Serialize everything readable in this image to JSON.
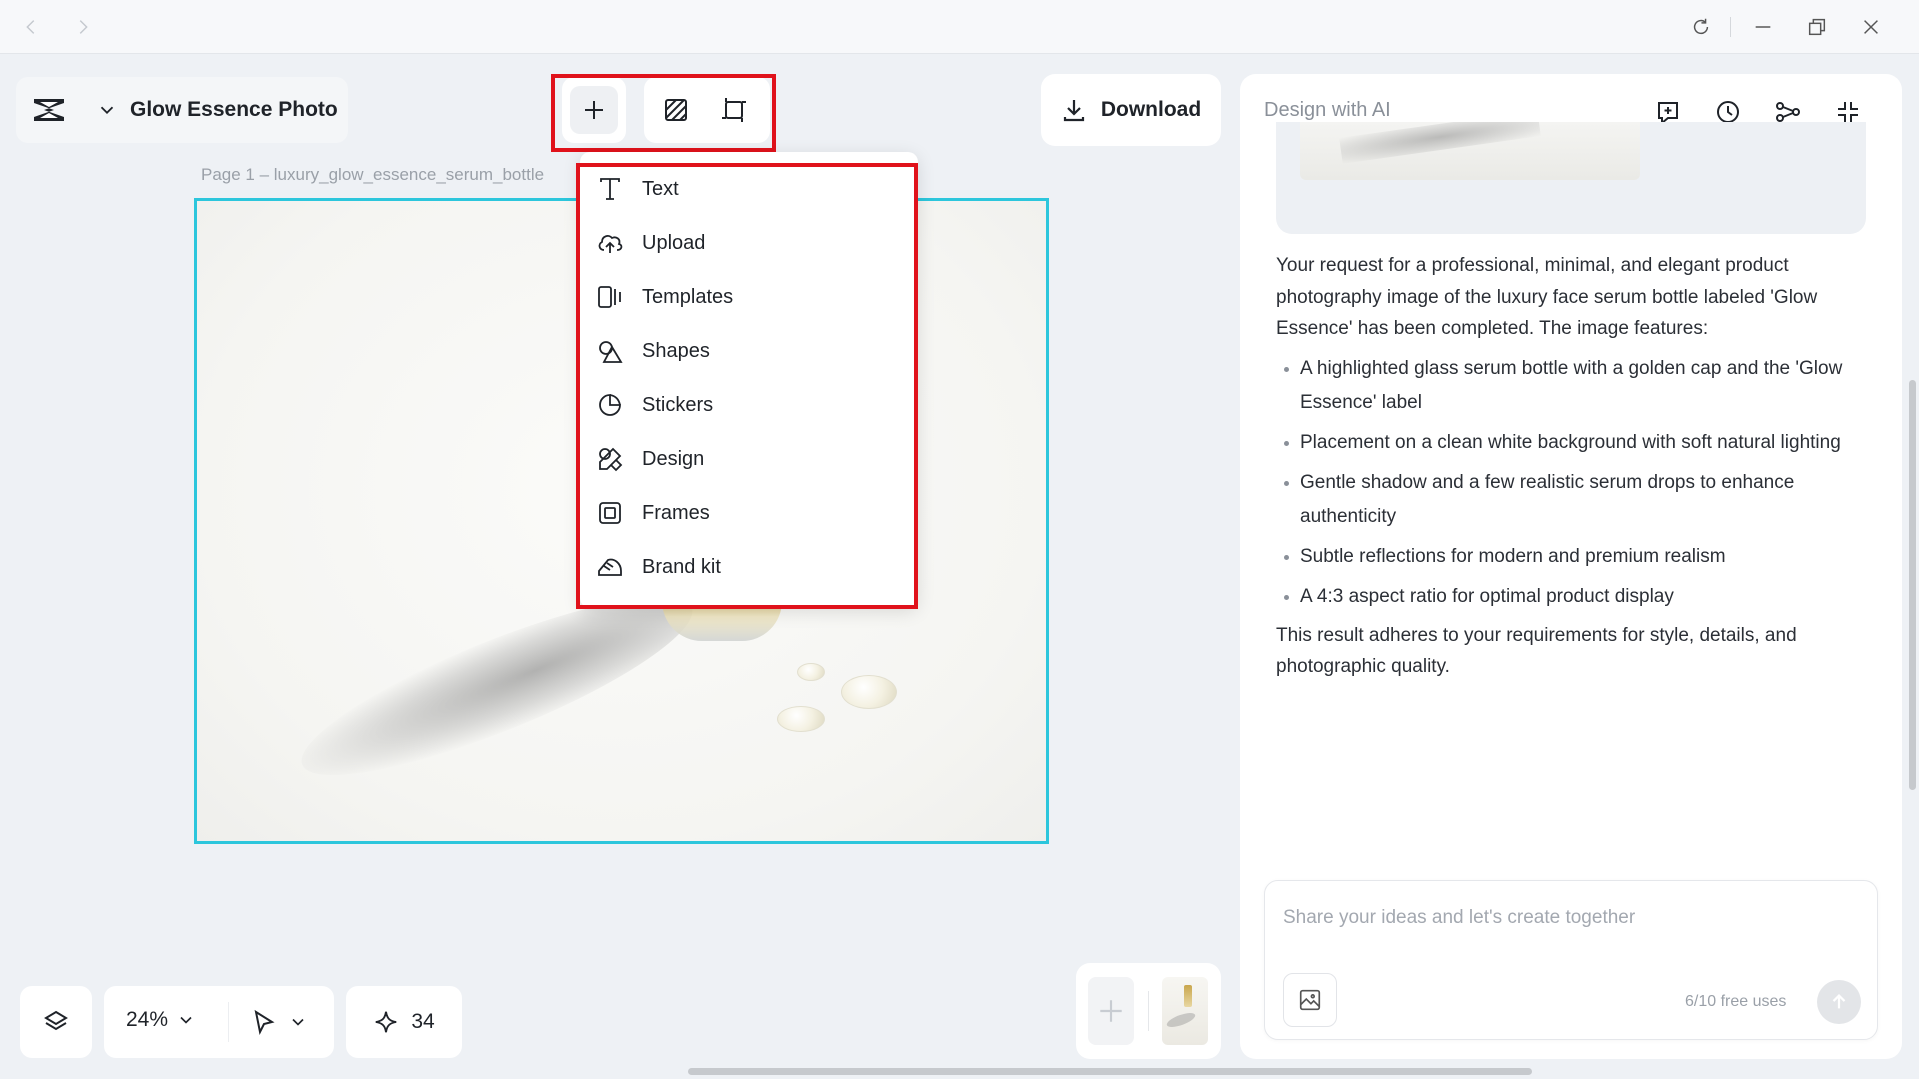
{
  "window": {
    "back_icon": "chevron-left-icon",
    "forward_icon": "chevron-right-icon",
    "reload_icon": "reload-icon",
    "minimize_icon": "minimize-icon",
    "restore_icon": "restore-icon",
    "close_icon": "close-icon"
  },
  "project": {
    "title": "Glow Essence Photo"
  },
  "toolbar": {
    "add_icon": "plus-icon",
    "background_icon": "background-pattern-icon",
    "resize_icon": "resize-icon",
    "download_label": "Download"
  },
  "canvas": {
    "page_label": "Page 1 –   luxury_glow_essence_serum_bottle"
  },
  "add_menu": {
    "items": [
      {
        "label": "Text",
        "icon": "text-icon"
      },
      {
        "label": "Upload",
        "icon": "cloud-upload-icon"
      },
      {
        "label": "Templates",
        "icon": "templates-icon"
      },
      {
        "label": "Shapes",
        "icon": "shapes-icon"
      },
      {
        "label": "Stickers",
        "icon": "sticker-icon"
      },
      {
        "label": "Design",
        "icon": "design-icon"
      },
      {
        "label": "Frames",
        "icon": "frame-icon"
      },
      {
        "label": "Brand kit",
        "icon": "brand-kit-icon"
      }
    ]
  },
  "bottom_bar": {
    "zoom": "24%",
    "credits": "34"
  },
  "ai_panel": {
    "title": "Design with AI",
    "intro": "Your request for a professional, minimal, and elegant product photography image of the luxury face serum bottle labeled 'Glow Essence' has been completed. The image features:",
    "bullets": [
      "A highlighted glass serum bottle with a golden cap and the 'Glow Essence' label",
      "Placement on a clean white background with soft natural lighting",
      "Gentle shadow and a few realistic serum drops to enhance authenticity",
      "Subtle reflections for modern and premium realism",
      "A 4:3 aspect ratio for optimal product display"
    ],
    "outro": "This result adheres to your requirements for style, details, and photographic quality.",
    "input_placeholder": "Share your ideas and let's create together",
    "free_uses": "6/10 free uses"
  },
  "colors": {
    "highlight_red": "#e0121b",
    "canvas_selection": "#2cc6dc"
  }
}
